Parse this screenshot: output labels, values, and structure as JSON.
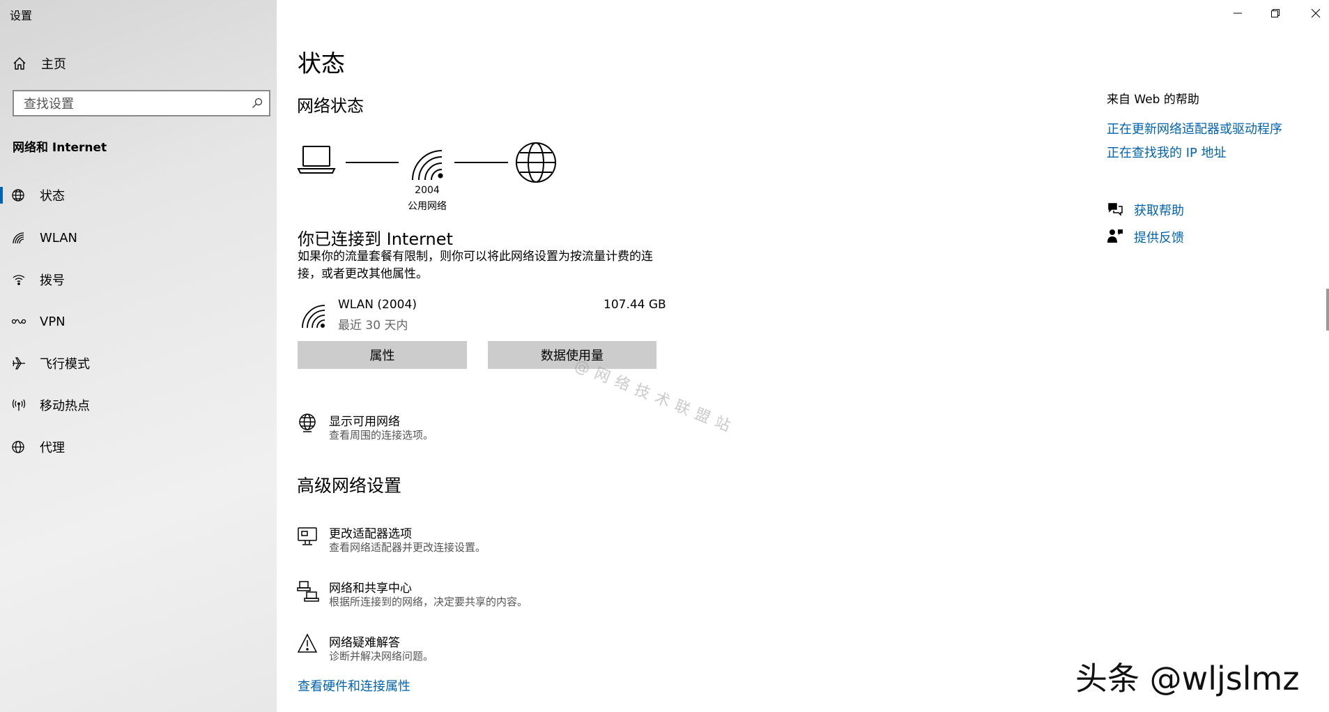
{
  "window": {
    "title": "设置",
    "controls": [
      "minimize-icon",
      "restore-icon",
      "close-icon"
    ]
  },
  "sidebar": {
    "home_label": "主页",
    "search_placeholder": "查找设置",
    "section_title": "网络和 Internet",
    "items": [
      {
        "label": "状态",
        "icon": "globe-status-icon",
        "active": true
      },
      {
        "label": "WLAN",
        "icon": "wifi-icon"
      },
      {
        "label": "拨号",
        "icon": "dialup-icon"
      },
      {
        "label": "VPN",
        "icon": "vpn-icon"
      },
      {
        "label": "飞行模式",
        "icon": "airplane-icon"
      },
      {
        "label": "移动热点",
        "icon": "hotspot-icon"
      },
      {
        "label": "代理",
        "icon": "globe-icon"
      }
    ]
  },
  "main": {
    "title": "状态",
    "network_status_heading": "网络状态",
    "network_name": "2004",
    "network_type": "公用网络",
    "connected_heading": "你已连接到 Internet",
    "connected_desc": "如果你的流量套餐有限制，则你可以将此网络设置为按流量计费的连接，或者更改其他属性。",
    "connection": {
      "name": "WLAN (2004)",
      "period": "最近 30 天内",
      "usage": "107.44 GB"
    },
    "buttons": {
      "properties": "属性",
      "data_usage": "数据使用量"
    },
    "show_networks": {
      "title": "显示可用网络",
      "subtitle": "查看周围的连接选项。"
    },
    "advanced_heading": "高级网络设置",
    "advanced_items": [
      {
        "title": "更改适配器选项",
        "subtitle": "查看网络适配器并更改连接设置。"
      },
      {
        "title": "网络和共享中心",
        "subtitle": "根据所连接到的网络，决定要共享的内容。"
      },
      {
        "title": "网络疑难解答",
        "subtitle": "诊断并解决网络问题。"
      }
    ],
    "hardware_link": "查看硬件和连接属性"
  },
  "help": {
    "title": "来自 Web 的帮助",
    "links": [
      "正在更新网络适配器或驱动程序",
      "正在查找我的 IP 地址"
    ],
    "get_help": "获取帮助",
    "feedback": "提供反馈"
  },
  "overlay": {
    "watermark": "@网络技术联盟站",
    "brand": "头条 @wljslmz"
  },
  "colors": {
    "accent": "#0063b1",
    "button": "#cccccc"
  }
}
